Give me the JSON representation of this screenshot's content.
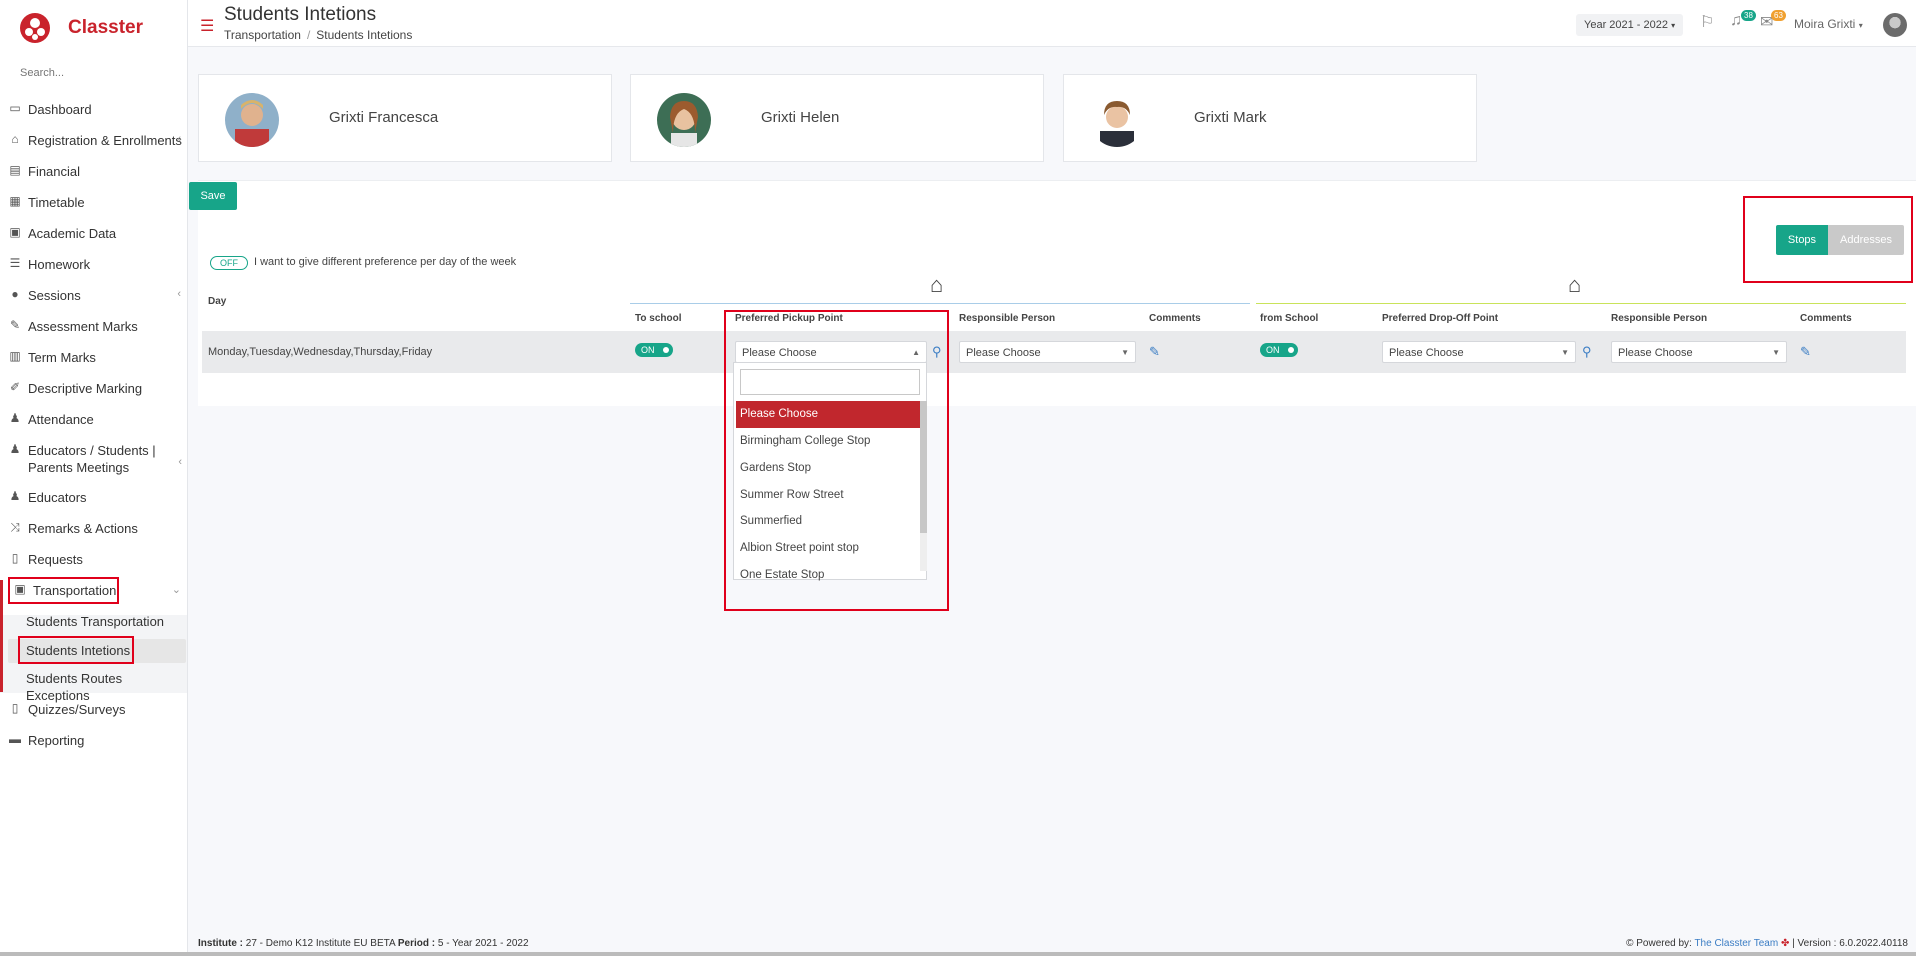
{
  "app": {
    "name": "Classter",
    "colors": {
      "brand": "#c9232c",
      "accent": "#17a589",
      "highlight_box": "#e0001b"
    }
  },
  "sidebar": {
    "search_placeholder": "Search...",
    "items": [
      {
        "label": "Dashboard",
        "icon": "laptop-icon"
      },
      {
        "label": "Registration & Enrollments",
        "icon": "bank-icon"
      },
      {
        "label": "Financial",
        "icon": "money-icon"
      },
      {
        "label": "Timetable",
        "icon": "calendar-icon"
      },
      {
        "label": "Academic Data",
        "icon": "id-card-icon"
      },
      {
        "label": "Homework",
        "icon": "list-icon"
      },
      {
        "label": "Sessions",
        "icon": "group-icon"
      },
      {
        "label": "Assessment Marks",
        "icon": "edit-icon"
      },
      {
        "label": "Term Marks",
        "icon": "book-icon"
      },
      {
        "label": "Descriptive Marking",
        "icon": "pencil-icon"
      },
      {
        "label": "Attendance",
        "icon": "user-check-icon"
      },
      {
        "label": "Educators / Students | Parents Meetings",
        "icon": "meeting-icon"
      },
      {
        "label": "Educators",
        "icon": "users-icon"
      },
      {
        "label": "Remarks & Actions",
        "icon": "shuffle-icon"
      },
      {
        "label": "Requests",
        "icon": "document-icon"
      },
      {
        "label": "Transportation",
        "icon": "bus-icon"
      },
      {
        "label": "Quizzes/Surveys",
        "icon": "quiz-icon"
      },
      {
        "label": "Reporting",
        "icon": "printer-icon"
      }
    ],
    "transport_sub": [
      "Students Transportation",
      "Students Intetions",
      "Students Routes Exceptions"
    ]
  },
  "header": {
    "title": "Students Intetions",
    "breadcrumb": [
      "Transportation",
      "Students Intetions"
    ],
    "year": "Year 2021 - 2022",
    "notif_count": "38",
    "msg_count": "63",
    "user": "Moira Grixti"
  },
  "students": [
    {
      "name": "Grixti Francesca"
    },
    {
      "name": "Grixti Helen"
    },
    {
      "name": "Grixti Mark"
    }
  ],
  "panel": {
    "save_label": "Save",
    "stops_label": "Stops",
    "addresses_label": "Addresses",
    "toggle_off": "OFF",
    "pref_label": "I want to give different preference per day of the week",
    "headers": {
      "day": "Day",
      "to_school": "To school",
      "pickup": "Preferred Pickup Point",
      "responsible1": "Responsible Person",
      "comments1": "Comments",
      "from_school": "from School",
      "dropoff": "Preferred Drop-Off Point",
      "responsible2": "Responsible Person",
      "comments2": "Comments"
    },
    "row": {
      "days": "Monday,Tuesday,Wednesday,Thursday,Friday",
      "to_school_on": "ON",
      "from_school_on": "ON",
      "pickup_value": "Please Choose",
      "resp1_value": "Please Choose",
      "dropoff_value": "Please Choose",
      "resp2_value": "Please Choose"
    },
    "dropdown_options": [
      "Please Choose",
      "Birmingham College Stop",
      "Gardens Stop",
      "Summer Row Street",
      "Summerfied",
      "Albion Street point stop",
      "One Estate Stop"
    ]
  },
  "footer": {
    "institute_label": "Institute :",
    "institute_value": "27 - Demo K12 Institute EU BETA",
    "period_label": "Period :",
    "period_value": "5 - Year 2021 - 2022",
    "powered_by": "Powered by:",
    "team": "The Classter Team",
    "version": "| Version : 6.0.2022.40118"
  }
}
